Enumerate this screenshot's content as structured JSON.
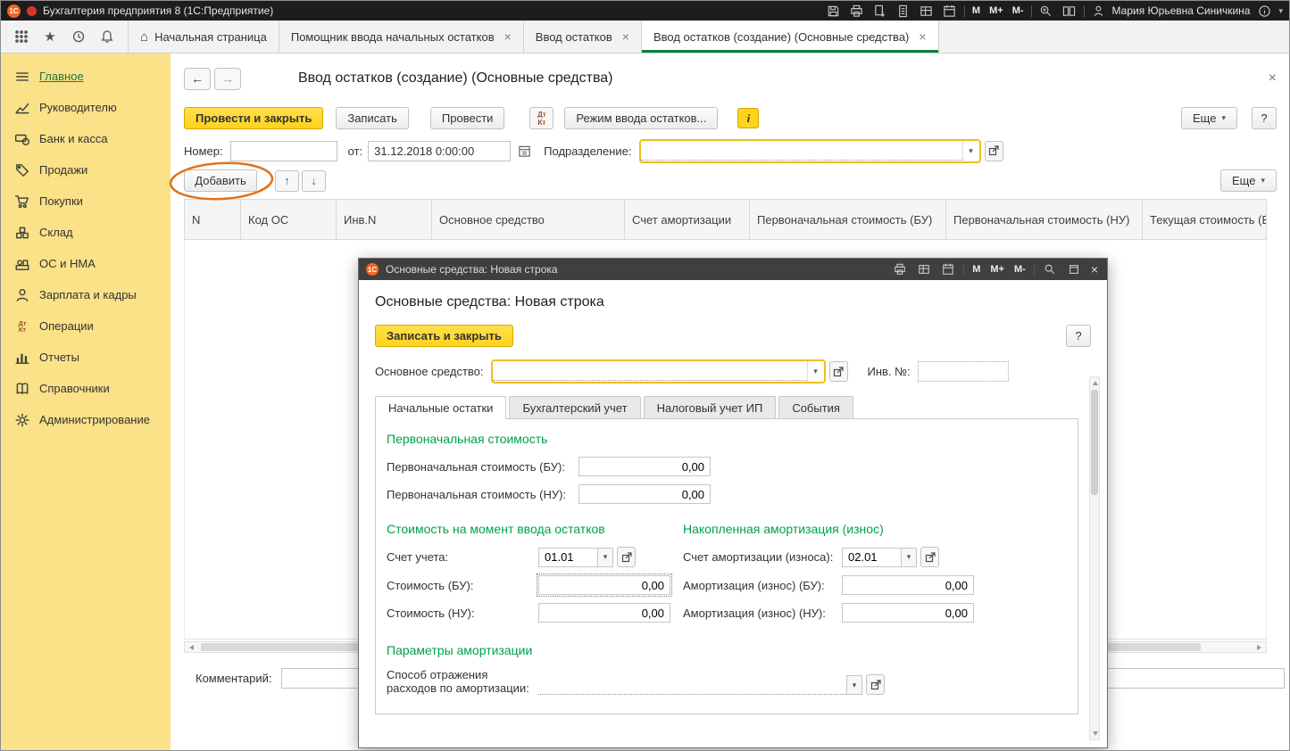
{
  "colors": {
    "accent_yellow": "#ffd21e",
    "sidebar_yellow": "#fbe187",
    "section_green": "#00a14b",
    "active_tab_green": "#0e7d3b",
    "annotation_orange": "#e0731d",
    "titlebar_dark": "#1d1d1d",
    "modal_titlebar_dark": "#3f3f3f"
  },
  "icons": {
    "logo": "1С",
    "close": "×",
    "dropdown": "▾",
    "up": "↑",
    "down": "↓",
    "back": "←",
    "forward": "→",
    "home": "⌂",
    "star": "★",
    "question": "?",
    "info": "i",
    "m": "M",
    "m_plus": "M+",
    "m_minus": "M-",
    "dt": "Дт",
    "kt": "Кт"
  },
  "titlebar": {
    "title": "Бухгалтерия предприятия 8  (1С:Предприятие)",
    "user": "Мария Юрьевна Синичкина"
  },
  "tabbar": {
    "tabs": [
      {
        "label": "Начальная страница"
      },
      {
        "label": "Помощник ввода начальных остатков"
      },
      {
        "label": "Ввод остатков"
      },
      {
        "label": "Ввод остатков (создание) (Основные средства)"
      }
    ]
  },
  "sidebar": {
    "items": [
      {
        "label": "Главное"
      },
      {
        "label": "Руководителю"
      },
      {
        "label": "Банк и касса"
      },
      {
        "label": "Продажи"
      },
      {
        "label": "Покупки"
      },
      {
        "label": "Склад"
      },
      {
        "label": "ОС и НМА"
      },
      {
        "label": "Зарплата и кадры"
      },
      {
        "label": "Операции"
      },
      {
        "label": "Отчеты"
      },
      {
        "label": "Справочники"
      },
      {
        "label": "Администрирование"
      }
    ]
  },
  "main": {
    "title": "Ввод остатков (создание) (Основные средства)",
    "toolbar": {
      "post_and_close": "Провести и закрыть",
      "write": "Записать",
      "post": "Провести",
      "mode": "Режим ввода остатков...",
      "more": "Еще"
    },
    "header_fields": {
      "number_label": "Номер:",
      "number_value": "",
      "from_label": "от:",
      "date_value": "31.12.2018 0:00:00",
      "department_label": "Подразделение:",
      "department_value": ""
    },
    "list_toolbar": {
      "add": "Добавить",
      "more": "Еще"
    },
    "table": {
      "columns": [
        "N",
        "Код ОС",
        "Инв.N",
        "Основное средство",
        "Счет амортизации",
        "Первоначальная стоимость (БУ)",
        "Первоначальная стоимость (НУ)",
        "Текущая стоимость (Б"
      ]
    },
    "comment_label": "Комментарий:",
    "comment_value": ""
  },
  "modal": {
    "window_title": "Основные средства: Новая строка",
    "heading": "Основные средства: Новая строка",
    "save_and_close": "Записать и закрыть",
    "asset_label": "Основное средство:",
    "asset_value": "",
    "inv_label": "Инв. №:",
    "inv_value": "",
    "tabs": [
      {
        "label": "Начальные остатки"
      },
      {
        "label": "Бухгалтерский учет"
      },
      {
        "label": "Налоговый учет ИП"
      },
      {
        "label": "События"
      }
    ],
    "initial_cost": {
      "title": "Первоначальная стоимость",
      "bu_label": "Первоначальная стоимость (БУ):",
      "bu_value": "0,00",
      "nu_label": "Первоначальная стоимость (НУ):",
      "nu_value": "0,00"
    },
    "entry_cost": {
      "title": "Стоимость на момент ввода остатков",
      "account_label": "Счет учета:",
      "account_value": "01.01",
      "bu_label": "Стоимость (БУ):",
      "bu_value": "0,00",
      "nu_label": "Стоимость (НУ):",
      "nu_value": "0,00"
    },
    "depreciation": {
      "title": "Накопленная амортизация (износ)",
      "account_label": "Счет амортизации (износа):",
      "account_value": "02.01",
      "bu_label": "Амортизация (износ) (БУ):",
      "bu_value": "0,00",
      "nu_label": "Амортизация (износ) (НУ):",
      "nu_value": "0,00"
    },
    "depreciation_params": {
      "title": "Параметры амортизации",
      "method_label_line1": "Способ отражения",
      "method_label_line2": "расходов по амортизации:",
      "method_value": ""
    }
  },
  "annotation": {
    "color": "#e0731d"
  }
}
